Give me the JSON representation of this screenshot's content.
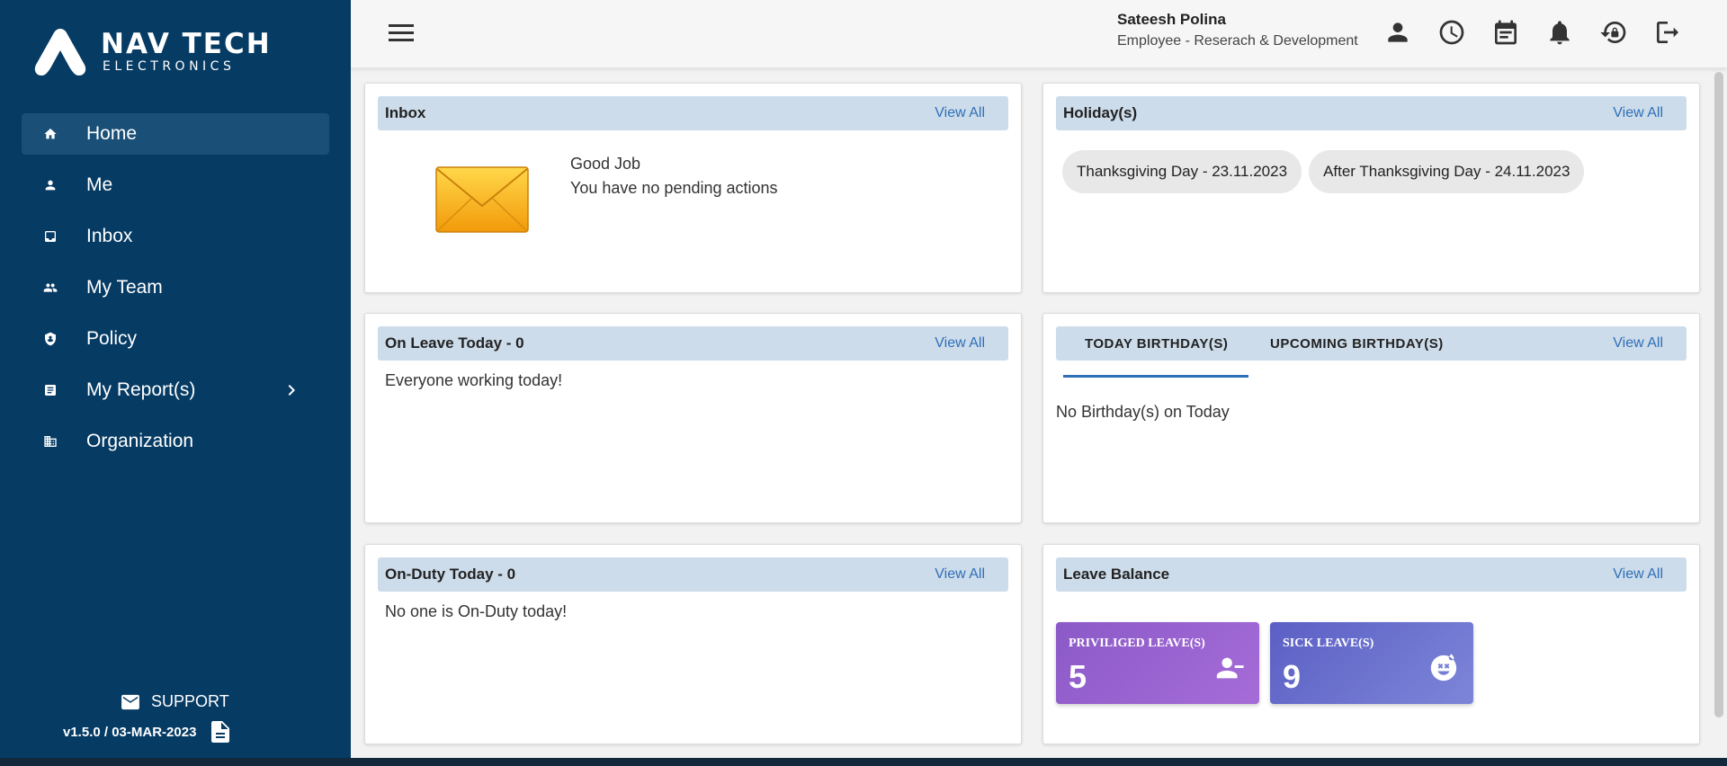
{
  "brand": {
    "name": "NAV TECH",
    "sub": "ELECTRONICS"
  },
  "sidebar": {
    "items": [
      {
        "label": "Home",
        "icon": "home-icon",
        "active": true
      },
      {
        "label": "Me",
        "icon": "person-icon"
      },
      {
        "label": "Inbox",
        "icon": "inbox-icon"
      },
      {
        "label": "My Team",
        "icon": "group-icon"
      },
      {
        "label": "Policy",
        "icon": "shield-icon"
      },
      {
        "label": "My Report(s)",
        "icon": "report-icon"
      },
      {
        "label": "Organization",
        "icon": "organization-icon"
      }
    ],
    "support_label": "SUPPORT",
    "version": "v1.5.0 / 03-MAR-2023"
  },
  "header": {
    "user_name": "Sateesh Polina",
    "user_role": "Employee - Reserach & Development",
    "icons": [
      "profile-icon",
      "clock-icon",
      "calendar-icon",
      "bell-icon",
      "lock-reset-icon",
      "logout-icon"
    ]
  },
  "view_all": "View All",
  "inbox": {
    "title": "Inbox",
    "line1": "Good Job",
    "line2": "You have no pending actions"
  },
  "holidays": {
    "title": "Holiday(s)",
    "items": [
      "Thanksgiving Day - 23.11.2023",
      "After Thanksgiving Day - 24.11.2023"
    ]
  },
  "on_leave": {
    "title": "On Leave Today - 0",
    "message": "Everyone working today!"
  },
  "birthdays": {
    "tab_today": "TODAY BIRTHDAY(S)",
    "tab_upcoming": "UPCOMING BIRTHDAY(S)",
    "message": "No Birthday(s) on Today"
  },
  "on_duty": {
    "title": "On-Duty Today - 0",
    "message": "No one is On-Duty today!"
  },
  "leave_balance": {
    "title": "Leave Balance",
    "tiles": [
      {
        "label": "PRIVILIGED LEAVE(S)",
        "value": "5"
      },
      {
        "label": "SICK LEAVE(S)",
        "value": "9"
      }
    ]
  },
  "colors": {
    "sidebar_bg": "#063b64",
    "active_item": "#1a4f77",
    "card_header": "#cddcea",
    "link": "#2f6fb8"
  }
}
